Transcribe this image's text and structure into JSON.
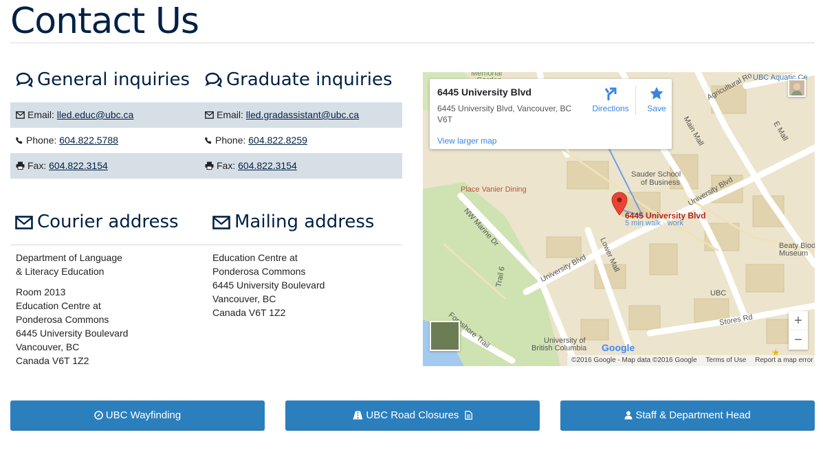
{
  "page_title": "Contact Us",
  "general": {
    "heading": "General inquiries",
    "email_label": "Email:",
    "email": "lled.educ@ubc.ca",
    "phone_label": "Phone:",
    "phone": "604.822.5788",
    "fax_label": "Fax:",
    "fax": "604.822.3154"
  },
  "graduate": {
    "heading": "Graduate inquiries",
    "email_label": "Email:",
    "email": "lled.gradassistant@ubc.ca",
    "phone_label": "Phone:",
    "phone": "604.822.8259",
    "fax_label": "Fax:",
    "fax": "604.822.3154"
  },
  "courier": {
    "heading": "Courier address",
    "lines1": [
      "Department of Language",
      "& Literacy Education"
    ],
    "lines2": [
      "Room 2013",
      "Education Centre at",
      "Ponderosa Commons",
      "6445 University Boulevard",
      "Vancouver, BC",
      "Canada V6T 1Z2"
    ]
  },
  "mailing": {
    "heading": "Mailing address",
    "lines": [
      "Education Centre at",
      "Ponderosa Commons",
      "6445 University Boulevard",
      "Vancouver, BC",
      "Canada V6T 1Z2"
    ]
  },
  "map": {
    "place_name": "6445 University Blvd",
    "address": "6445 University Blvd, Vancouver, BC V6T",
    "view_larger": "View larger map",
    "directions": "Directions",
    "save": "Save",
    "pin_label": "6445 University Blvd",
    "pin_sub": "5 min walk · work",
    "labels": {
      "aquatic": "UBC Aquatic Ce",
      "agricultural": "Agricultural Ro",
      "main_mall": "Main Mall",
      "e_mall": "E Mall",
      "sauder": "Sauder School",
      "sauder2": "of Business",
      "vanier": "Place Vanier Dining",
      "university_blvd_ne": "University Blvd",
      "nw_marine": "NW Marine Dr",
      "lower_mall": "Lower Mall",
      "university_blvd": "University Blvd",
      "beaty": "Beaty Biod",
      "beaty2": "Museum",
      "trail6": "Trail 6",
      "ubc": "UBC",
      "stores": "Stores Rd",
      "foreshore": "Foreshore Trail",
      "ubc_full": "University of",
      "ubc_full2": "British Columbia",
      "memorial": "Memorial",
      "garden": "Garden"
    },
    "google": "Google",
    "footer_copy": "©2016 Google - Map data ©2016 Google",
    "terms": "Terms of Use",
    "report": "Report a map error",
    "zoom_in": "+",
    "zoom_out": "−"
  },
  "buttons": {
    "wayfinding": "UBC Wayfinding",
    "road": "UBC Road Closures",
    "staff": "Staff & Department Head"
  },
  "colors": {
    "heading": "#002145",
    "button": "#2b7fbd",
    "row_shade": "#d6dee6",
    "map_land": "#ece4cc"
  }
}
